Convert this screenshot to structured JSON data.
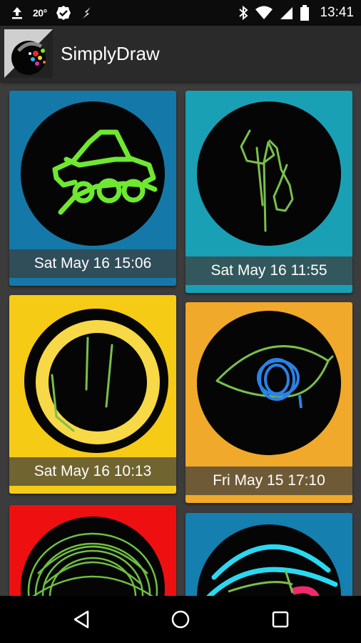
{
  "status_bar": {
    "temperature": "20°",
    "time": "13:41",
    "icons": [
      "upload-icon",
      "weather-icon",
      "check-badge-icon",
      "lightning-icon",
      "bluetooth-icon",
      "wifi-icon",
      "cell-signal-icon",
      "battery-icon"
    ]
  },
  "app_bar": {
    "title": "SimplyDraw",
    "icon": "app-logo-icon"
  },
  "drawings": [
    {
      "caption": "Sat May 16 15:06",
      "background": "#1479a8",
      "drawing": "green car"
    },
    {
      "caption": "Sat May 16 11:55",
      "background": "#1aa0b5",
      "drawing": "green squiggle"
    },
    {
      "caption": "Sat May 16 10:13",
      "background": "#f6cb16",
      "drawing": "yellow ring"
    },
    {
      "caption": "Fri May 15 17:10",
      "background": "#f0a92a",
      "drawing": "blue eye"
    },
    {
      "caption": "",
      "background": "#ee1010",
      "drawing": "green scribble"
    },
    {
      "caption": "",
      "background": "#157fb0",
      "drawing": "cyan arcs"
    }
  ],
  "nav_bar": {
    "buttons": [
      "back-icon",
      "home-icon",
      "recents-icon"
    ]
  }
}
